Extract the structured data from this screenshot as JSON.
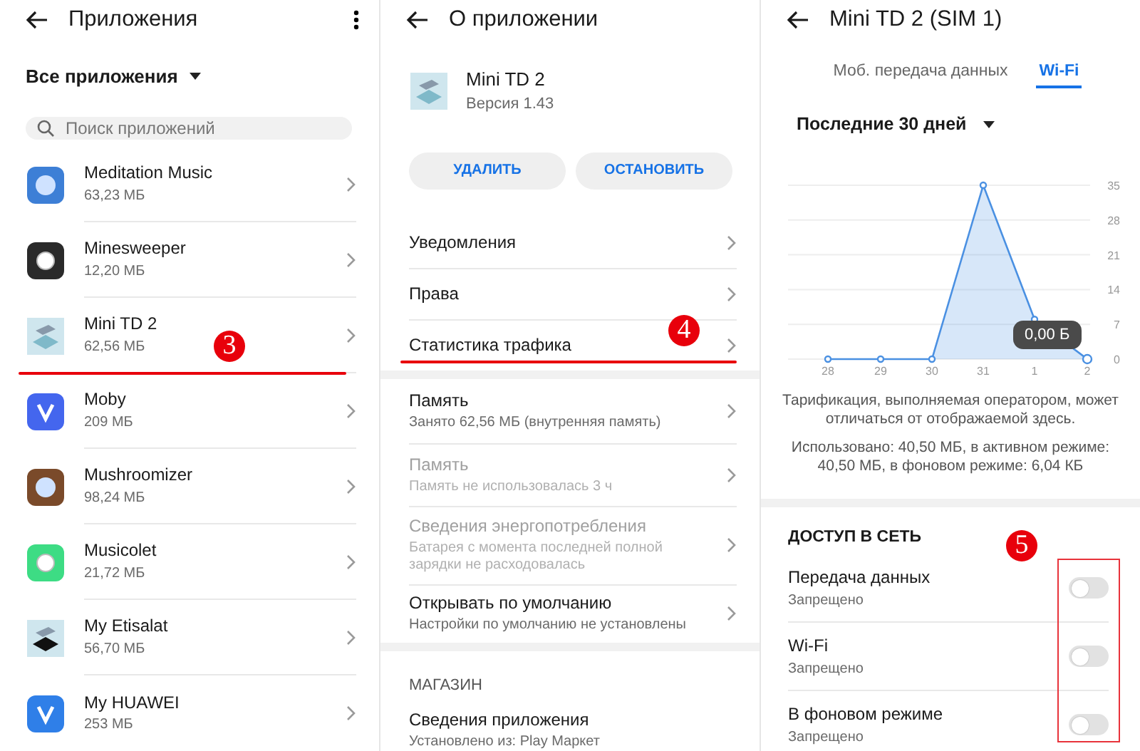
{
  "panels": [
    {
      "kind": "app_list",
      "title": "Приложения",
      "filter": "Все приложения",
      "search": {
        "placeholder": "Поиск приложений"
      },
      "apps": [
        {
          "name": "Meditation Music",
          "size": "63,23 МБ"
        },
        {
          "name": "Minesweeper",
          "size": "12,20 МБ"
        },
        {
          "name": "Mini TD 2",
          "size": "62,56 МБ"
        },
        {
          "name": "Moby",
          "size": "209 МБ"
        },
        {
          "name": "Mushroomizer",
          "size": "98,24 МБ"
        },
        {
          "name": "Musicolet",
          "size": "21,72 МБ"
        },
        {
          "name": "My Etisalat",
          "size": "56,70 МБ"
        },
        {
          "name": "My HUAWEI",
          "size": "253 МБ"
        }
      ],
      "annotation": {
        "number": "3",
        "kind": "underline"
      }
    },
    {
      "kind": "app_info",
      "title": "О приложении",
      "app": {
        "name": "Mini TD 2",
        "version": "Версия 1.43"
      },
      "buttons": [
        "УДАЛИТЬ",
        "ОСТАНОВИТЬ"
      ],
      "groups": [
        [
          {
            "label": "Уведомления",
            "disabled": false
          },
          {
            "label": "Права",
            "disabled": false
          },
          {
            "label": "Статистика трафика",
            "disabled": false
          }
        ],
        [
          {
            "label": "Память",
            "detail": "Занято 62,56 МБ (внутренняя память)",
            "disabled": false
          },
          {
            "label": "Память",
            "detail": "Память не использовалась 3 ч",
            "disabled": true
          },
          {
            "label": "Сведения энергопотребления",
            "detail": "Батарея с момента последней полной зарядки не расходовалась",
            "disabled": true
          },
          {
            "label": "Открывать по умолчанию",
            "detail": "Настройки по умолчанию не установлены",
            "disabled": false
          }
        ]
      ],
      "store": {
        "heading": "МАГАЗИН",
        "label": "Сведения приложения",
        "detail": "Установлено из: Play Маркет"
      },
      "annotation": {
        "number": "4",
        "kind": "underline"
      }
    },
    {
      "kind": "traffic",
      "title": "Mini TD 2 (SIM 1)",
      "tabs": [
        {
          "label": "Моб. передача данных",
          "selected": false
        },
        {
          "label": "Wi-Fi",
          "selected": true
        }
      ],
      "period": "Последние 30 дней",
      "chart_data": {
        "type": "area",
        "categories": [
          "28",
          "29",
          "30",
          "31",
          "1",
          "2"
        ],
        "series": [
          {
            "color": "#4a90e2",
            "values": [
              0,
              0,
              0,
              35,
              8,
              0
            ]
          }
        ],
        "ylim": [
          0,
          35
        ],
        "yticks": [
          0,
          7,
          14,
          21,
          28,
          35
        ],
        "grid": true
      },
      "tooltip": "0,00 Б",
      "notes": [
        "Тарификация, выполняемая оператором, может отличаться от отображаемой здесь.",
        "Использовано: 40,50 МБ, в активном режиме: 40,50 МБ, в фоновом режиме: 6,04 КБ"
      ],
      "access": {
        "heading": "ДОСТУП В СЕТЬ",
        "items": [
          {
            "label": "Передача данных",
            "status": "Запрещено",
            "on": false
          },
          {
            "label": "Wi-Fi",
            "status": "Запрещено",
            "on": false
          },
          {
            "label": "В фоновом режиме",
            "status": "Запрещено",
            "on": false
          }
        ]
      },
      "annotation": {
        "number": "5",
        "kind": "box"
      }
    }
  ]
}
